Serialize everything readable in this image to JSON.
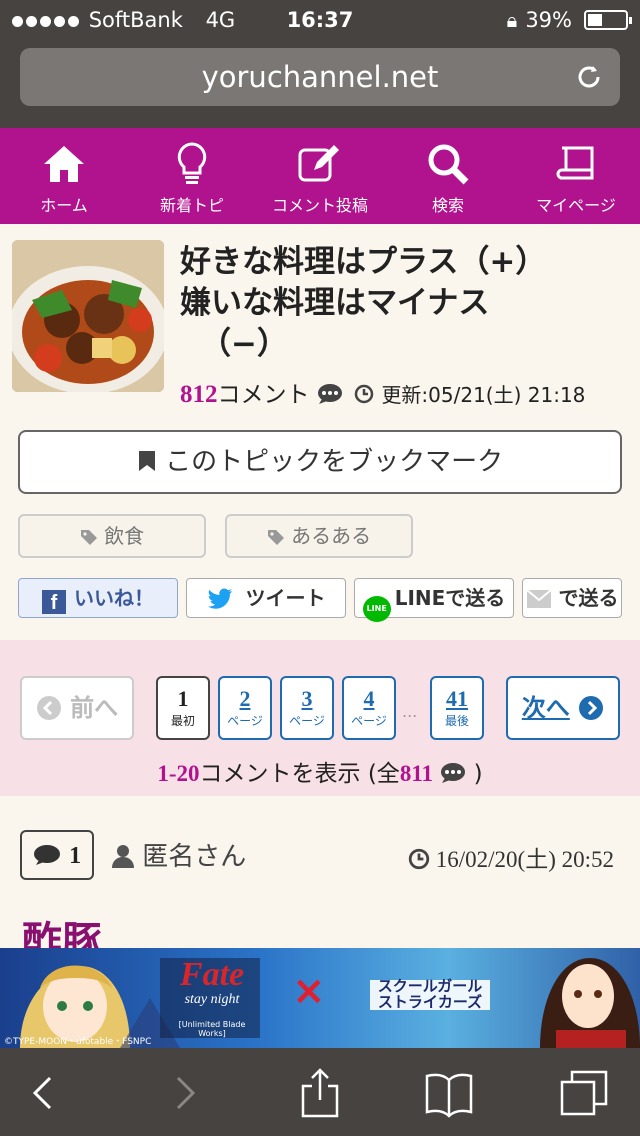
{
  "status": {
    "carrier": "SoftBank",
    "network": "4G",
    "time": "16:37",
    "battery": "39%"
  },
  "browser": {
    "url": "yoruchannel.net"
  },
  "nav": {
    "items": [
      {
        "label": "ホーム",
        "icon": "home-icon"
      },
      {
        "label": "新着トピ",
        "icon": "bulb-icon"
      },
      {
        "label": "コメント投稿",
        "icon": "edit-icon"
      },
      {
        "label": "検索",
        "icon": "search-icon"
      },
      {
        "label": "マイページ",
        "icon": "book-icon"
      }
    ]
  },
  "topic": {
    "title_line1": "好きな料理はプラス（+）",
    "title_line2": "嫌いな料理はマイナス",
    "title_line3": "（−）",
    "comment_count": "812",
    "comment_label": "コメント",
    "updated": "更新:05/21(土) 21:18"
  },
  "bookmark": {
    "label": "このトピックをブックマーク"
  },
  "tags": [
    "飲食",
    "あるある"
  ],
  "share": {
    "facebook": "いいね！",
    "twitter": "ツイート",
    "line": "LINEで送る",
    "mail": "で送る"
  },
  "pager": {
    "prev": "前へ",
    "next": "次へ",
    "pages": [
      {
        "num": "1",
        "sub": "最初"
      },
      {
        "num": "2",
        "sub": "ページ"
      },
      {
        "num": "3",
        "sub": "ページ"
      },
      {
        "num": "4",
        "sub": "ページ"
      },
      {
        "num": "41",
        "sub": "最後"
      }
    ],
    "ellipsis": "...",
    "range": "1-20",
    "range_text": "コメントを表示 (全",
    "total": "811",
    "range_end": ")"
  },
  "comment": {
    "number": "1",
    "author": "匿名さん",
    "date": "16/02/20(土) 20:52",
    "body_start": "酢豚"
  },
  "banner": {
    "copyright": "©TYPE-MOON・ufotable・FSNPC",
    "left_title": "Fate",
    "left_sub": "stay night",
    "left_tag": "[Unlimited Blade Works]",
    "cross": "×",
    "right_title": "スクールガール",
    "right_title2": "ストライカーズ"
  },
  "colors": {
    "brand": "#b1128e",
    "link": "#1f6bb0",
    "pager_bg": "#f8e1e6"
  }
}
